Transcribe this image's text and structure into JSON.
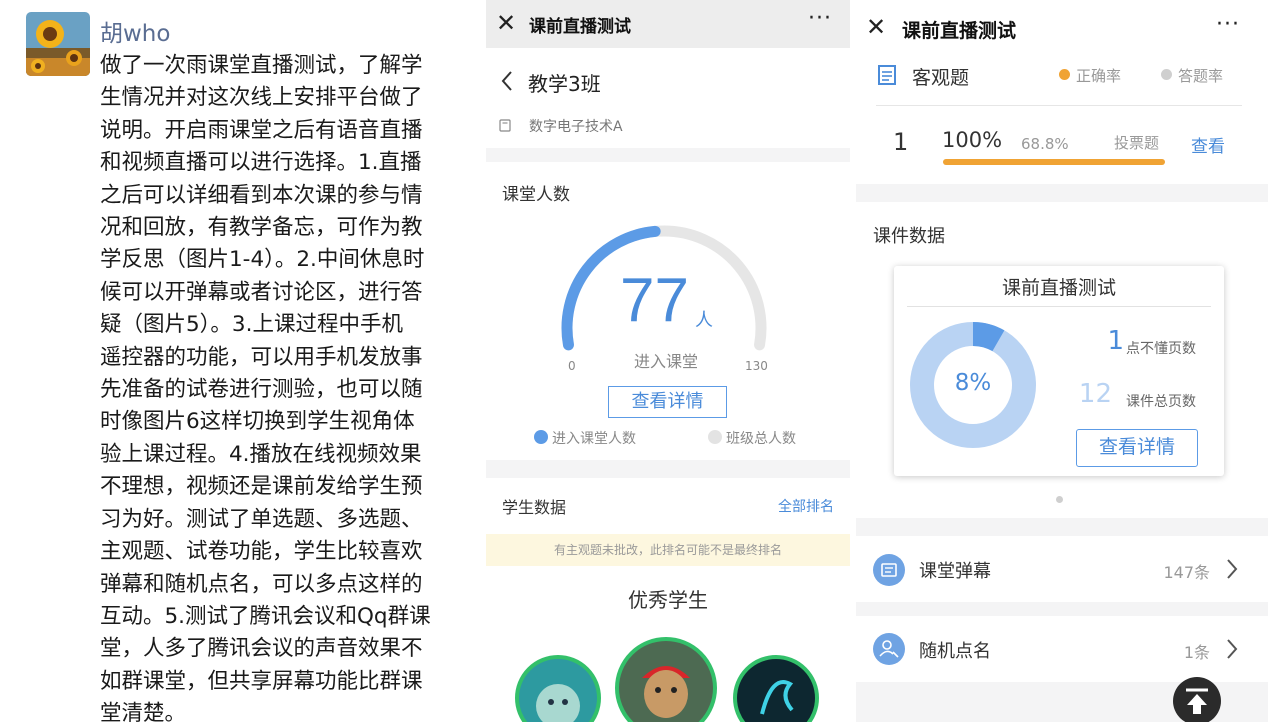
{
  "post": {
    "author": "胡who",
    "lines": [
      "做了一次雨课堂直播测试，了解学",
      "生情况并对这次线上安排平台做了",
      "说明。开启雨课堂之后有语音直播",
      "和视频直播可以进行选择。1.直播",
      "之后可以详细看到本次课的参与情",
      "况和回放，有教学备忘，可作为教",
      "学反思（图片1-4）。2.中间休息时",
      "候可以开弹幕或者讨论区，进行答",
      "疑（图片5）。3.上课过程中手机",
      "遥控器的功能，可以用手机发放事",
      "先准备的试卷进行测验，也可以随",
      "时像图片6这样切换到学生视角体",
      "验上课过程。4.播放在线视频效果",
      "不理想，视频还是课前发给学生预",
      "习为好。测试了单选题、多选题、",
      "主观题、试卷功能，学生比较喜欢",
      "弹幕和随机点名，可以多点这样的",
      "互动。5.测试了腾讯会议和Qq群课",
      "堂，人多了腾讯会议的声音效果不",
      "如群课堂，但共享屏幕功能比群课",
      "堂清楚。"
    ]
  },
  "middle": {
    "topbar": {
      "close": "✕",
      "title": "课前直播测试",
      "more": "···"
    },
    "class_name": "教学3班",
    "course": "数字电子技术A",
    "attendance": {
      "title": "课堂人数",
      "value": 77,
      "max": 130,
      "count_label": "77",
      "unit": "人",
      "sub": "进入课堂",
      "min_label": "0",
      "max_label": "130",
      "button": "查看详情",
      "legend": [
        "进入课堂人数",
        "班级总人数"
      ]
    },
    "students": {
      "title": "学生数据",
      "link": "全部排名",
      "notice": "有主观题未批改，此排名可能不是最终排名",
      "heading": "优秀学生"
    }
  },
  "right": {
    "topbar": {
      "close": "✕",
      "title": "课前直播测试",
      "more": "···"
    },
    "objective": {
      "title": "客观题",
      "legend": [
        "正确率",
        "答题率"
      ],
      "row": {
        "index": "1",
        "correct": "100%",
        "answered": "68.8%",
        "kind": "投票题",
        "action": "查看",
        "progress": 1.0
      }
    },
    "courseware": {
      "title": "课件数据",
      "card_title": "课前直播测试",
      "percent_label": "8%",
      "ratio": 0.083,
      "stat1_value": "1",
      "stat1_label": "点不懂页数",
      "stat2_value": "12",
      "stat2_label": "课件总页数",
      "button": "查看详情"
    },
    "danmu": {
      "label": "课堂弹幕",
      "count": "147条"
    },
    "rollcall": {
      "label": "随机点名",
      "count": "1条"
    }
  },
  "colors": {
    "accent": "#4a8bd9",
    "orange": "#f0a334",
    "light_blue": "#b9d3f3"
  }
}
